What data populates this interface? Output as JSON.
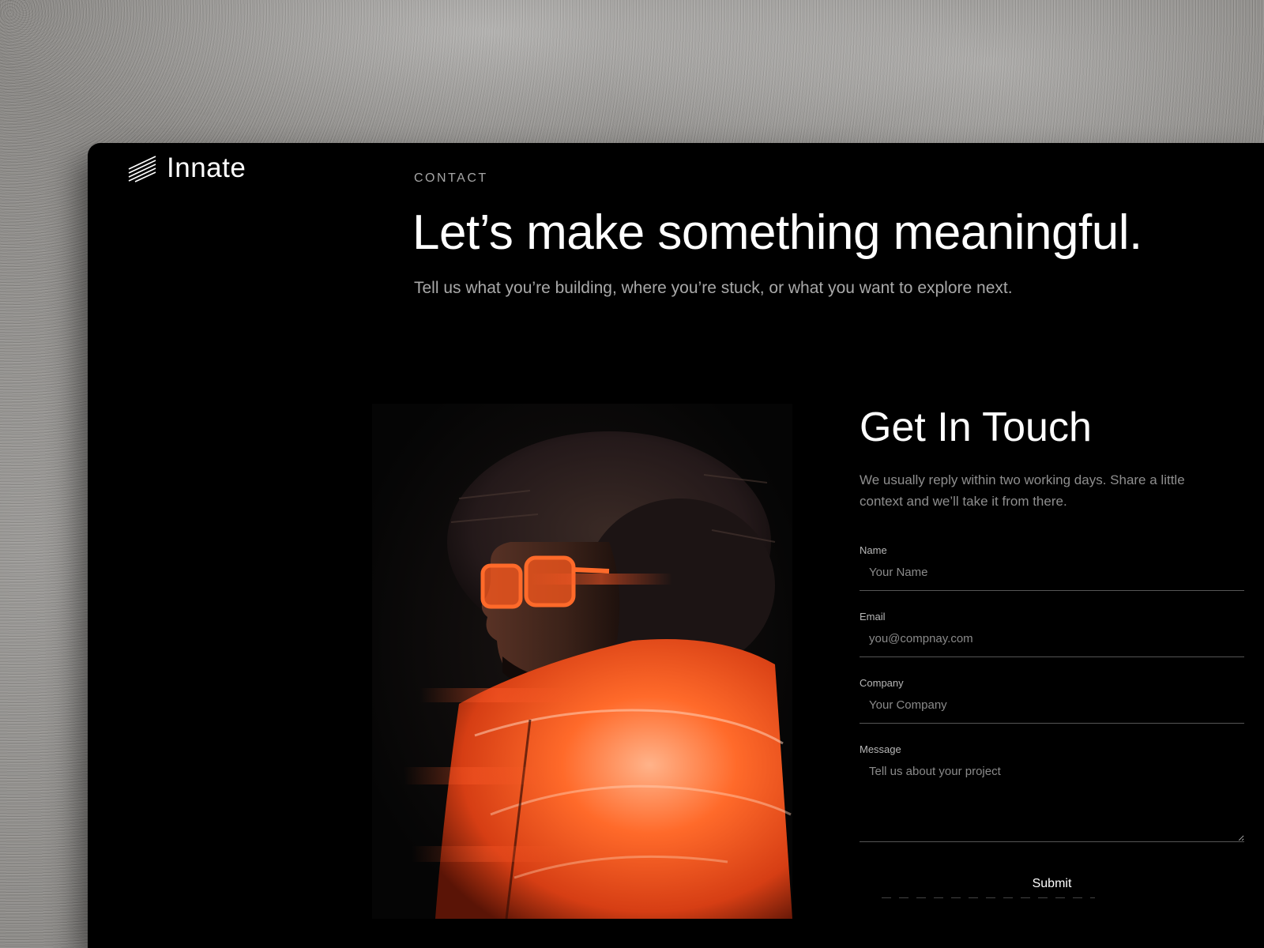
{
  "brand": {
    "name": "Innate",
    "icon": "diagonal-lines-logo-icon"
  },
  "hero": {
    "eyebrow": "CONTACT",
    "headline": "Let’s make something meaningful.",
    "subhead": "Tell us what you’re building, where you’re stuck, or what you want to explore next."
  },
  "photo": {
    "subject": "portrait-photo"
  },
  "form": {
    "title": "Get In Touch",
    "description": "We usually reply within two working days. Share a little context and we’ll take it from there.",
    "fields": {
      "name": {
        "label": "Name",
        "placeholder": "Your Name"
      },
      "email": {
        "label": "Email",
        "placeholder": "you@compnay.com"
      },
      "company": {
        "label": "Company",
        "placeholder": "Your Company"
      },
      "message": {
        "label": "Message",
        "placeholder": "Tell us about your project"
      }
    },
    "submit_label": "Submit"
  },
  "colors": {
    "background": "#000000",
    "text": "#ffffff",
    "muted_text": "#a9a9a9",
    "accent_orange": "#ff5a1f",
    "wall": "#8f8d8a"
  }
}
